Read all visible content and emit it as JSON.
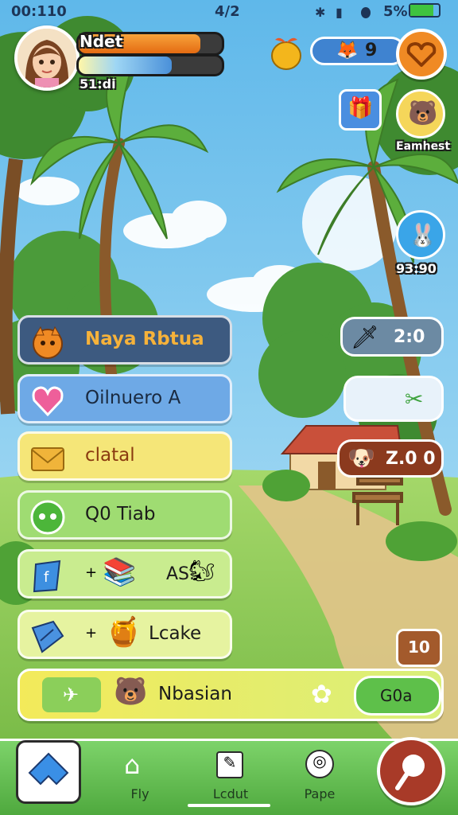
{
  "status_bar": {
    "time": "00:110",
    "center": "4/2",
    "battery": "5%"
  },
  "player": {
    "name": "Ndet",
    "coins": "51:di",
    "health_level": 0.85,
    "energy_level": 0.65
  },
  "top_right": {
    "resource_count": "9"
  },
  "right_panel": {
    "bear_label": "Eamhest",
    "bunny_count": "93:90",
    "sword_value": "2:0",
    "dog_value": "Z.0 0",
    "bag_label": "10"
  },
  "menu": {
    "items": [
      {
        "label": "Naya Rbtua"
      },
      {
        "label": "Oilnuero A"
      },
      {
        "label": "clatal"
      },
      {
        "label": "Q0 Tiab"
      },
      {
        "label": "AS."
      },
      {
        "label": "Lcake"
      }
    ]
  },
  "bottom_banner": {
    "label": "Nbasian",
    "button_label": "G0a"
  },
  "nav": {
    "items": [
      "Fly",
      "Lcdut",
      "Pape"
    ]
  },
  "colors": {
    "sky": "#7ec8ef",
    "grass": "#8cc653",
    "accent_orange": "#f08a24",
    "nav_green": "#5fb84b"
  }
}
